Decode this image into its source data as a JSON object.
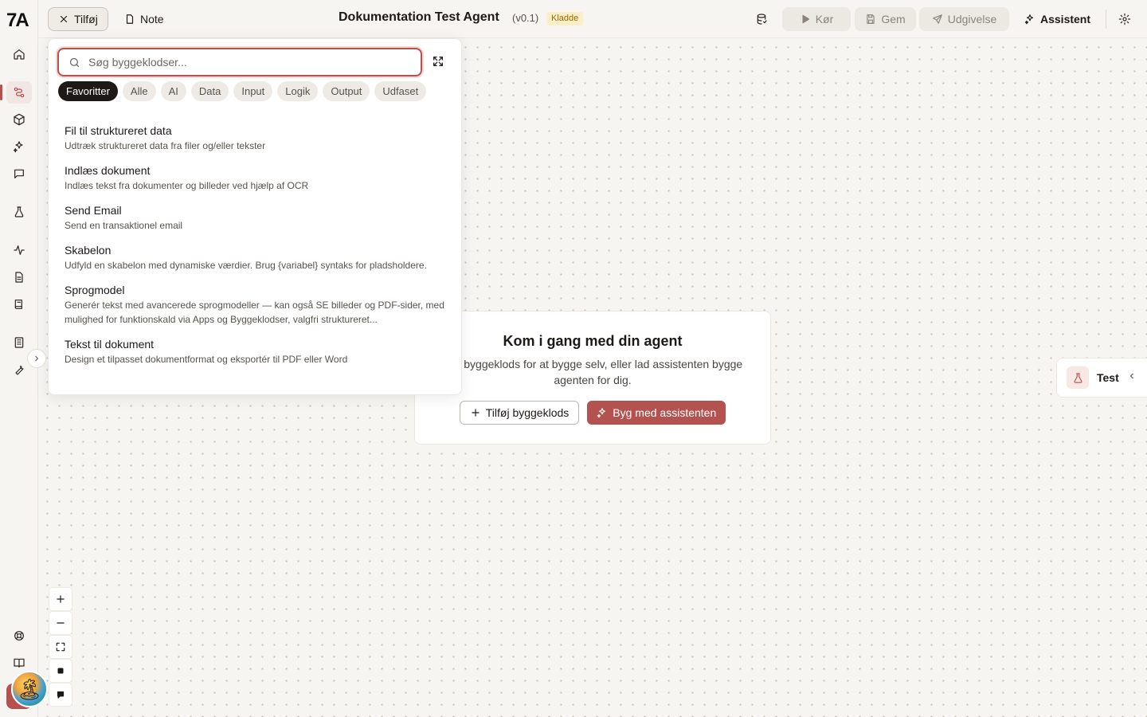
{
  "app": {
    "logo": "7A"
  },
  "topbar": {
    "add_label": "Tilføj",
    "note_label": "Note",
    "title": "Dokumentation Test Agent",
    "version": "(v0.1)",
    "status_badge": "Kladde",
    "run_label": "Kør",
    "save_label": "Gem",
    "publish_label": "Udgivelse",
    "assistant_label": "Assistent"
  },
  "picker": {
    "search_placeholder": "Søg byggeklodser...",
    "search_value": "",
    "filters": [
      "Favoritter",
      "Alle",
      "AI",
      "Data",
      "Input",
      "Logik",
      "Output",
      "Udfaset"
    ],
    "active_filter": "Favoritter",
    "items": [
      {
        "title": "Fil til struktureret data",
        "desc": "Udtræk struktureret data fra filer og/eller tekster"
      },
      {
        "title": "Indlæs dokument",
        "desc": "Indlæs tekst fra dokumenter og billeder ved hjælp af OCR"
      },
      {
        "title": "Send Email",
        "desc": "Send en transaktionel email"
      },
      {
        "title": "Skabelon",
        "desc": "Udfyld en skabelon med dynamiske værdier. Brug {variabel} syntaks for pladsholdere."
      },
      {
        "title": "Sprogmodel",
        "desc": "Generér tekst med avancerede sprogmodeller — kan også SE billeder og PDF-sider, med mulighed for funktionskald via Apps og Byggeklodser, valgfri struktureret..."
      },
      {
        "title": "Tekst til dokument",
        "desc": "Design et tilpasset dokumentformat og eksportér til PDF eller Word"
      }
    ]
  },
  "start_card": {
    "title": "Kom i gang med din agent",
    "subtitle": "j en byggeklods for at bygge selv, eller lad assistenten bygge agenten for dig.",
    "add_block_label": "Tilføj byggeklods",
    "build_assistant_label": "Byg med assistenten"
  },
  "test_panel": {
    "label": "Test"
  },
  "colors": {
    "accent": "#b4524f",
    "badge_bg": "#fbefc7",
    "badge_text": "#9a6a05"
  }
}
